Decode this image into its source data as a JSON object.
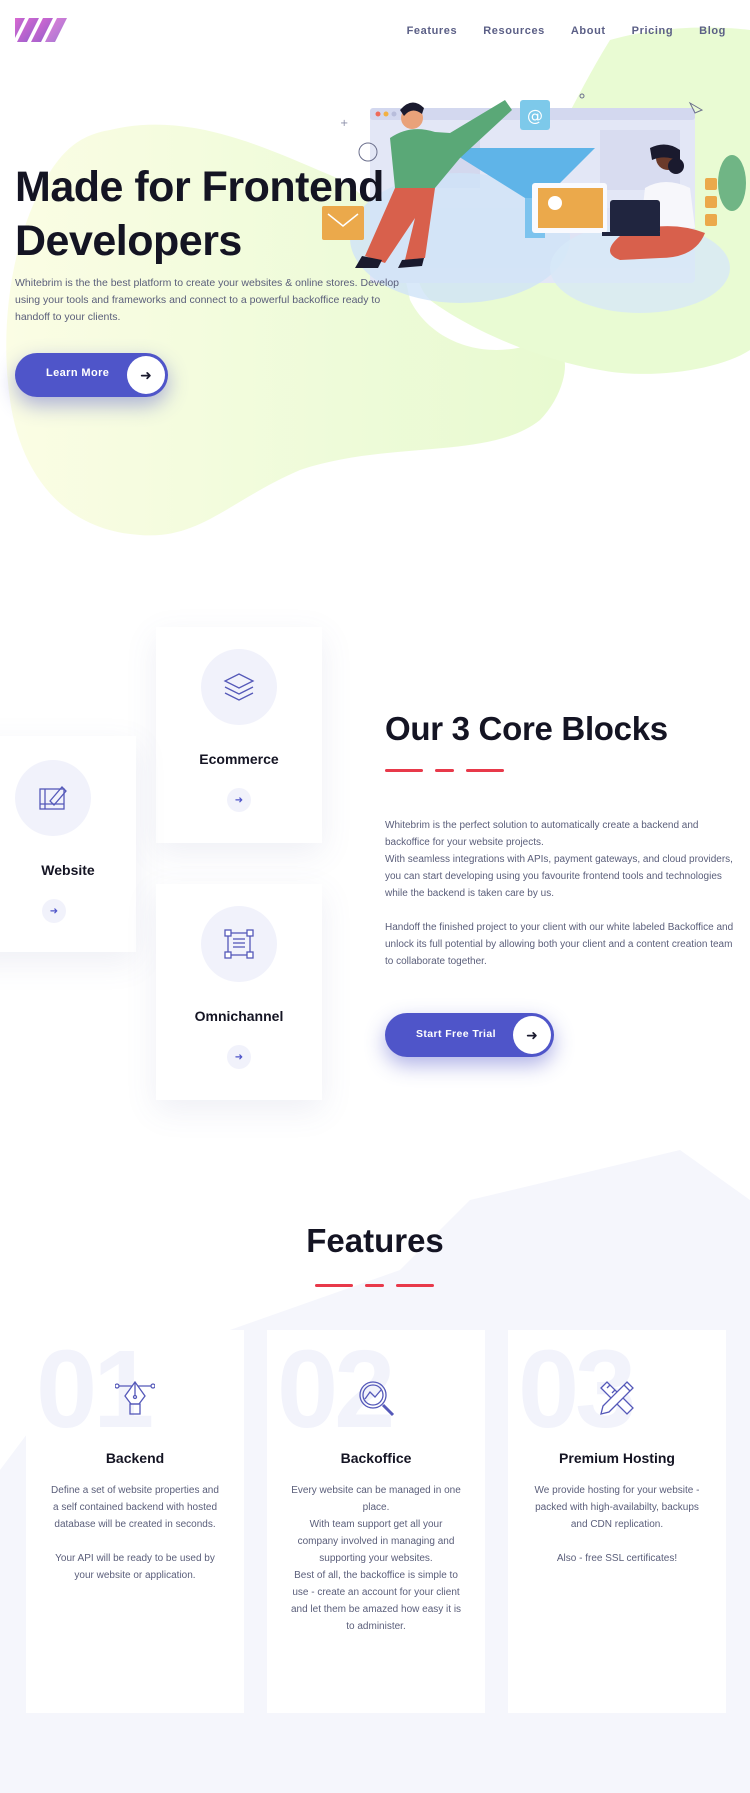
{
  "header": {
    "logo_icon": "stripes-logo-icon",
    "nav": [
      "Features",
      "Resources",
      "About",
      "Pricing",
      "Blog"
    ]
  },
  "hero": {
    "title": "Made for Frontend Developers",
    "description": "Whitebrim is the the best platform to create your websites & online stores. Develop using your tools and frameworks and connect to a powerful backoffice ready to handoff to your clients.",
    "cta_label": "Learn More",
    "cta_icon": "arrow-right-icon",
    "illustration": "team-workflow-illustration"
  },
  "core": {
    "cards": [
      {
        "title": "Ecommerce",
        "icon": "layers-icon"
      },
      {
        "title": "Website",
        "icon": "design-board-icon"
      },
      {
        "title": "Omnichannel",
        "icon": "layout-frame-icon"
      }
    ],
    "title": "Our 3 Core Blocks",
    "paragraph_1": "Whitebrim is the perfect solution to automatically create a backend and backoffice for your website projects.\nWith seamless integrations with APIs, payment gateways, and cloud providers, you can start developing using you favourite frontend tools and technologies while the backend is taken care by us.",
    "paragraph_2": "Handoff the finished project to your client with our white labeled Backoffice and unlock its full potential by allowing both your client and a content creation team to collaborate together.",
    "cta_label": "Start Free Trial"
  },
  "features": {
    "title": "Features",
    "items": [
      {
        "number": "01",
        "icon": "pen-tool-icon",
        "title": "Backend",
        "lines": [
          "Define a set of website properties and",
          "a self contained backend with hosted",
          "database will be created in seconds.",
          "",
          "Your API will be ready to be used by",
          "your website or application."
        ]
      },
      {
        "number": "02",
        "icon": "magnifier-chart-icon",
        "title": "Backoffice",
        "lines": [
          "Every website can be managed in one",
          "place.",
          "With team support get all your",
          "company involved in managing and",
          "supporting your websites.",
          "Best of all, the backoffice is simple to",
          "use - create an account for your client",
          "and let them be amazed how easy it is",
          "to administer."
        ]
      },
      {
        "number": "03",
        "icon": "pencil-ruler-icon",
        "title": "Premium Hosting",
        "lines": [
          "We provide hosting for your website -",
          "packed with high-availabilty, backups",
          "and CDN replication.",
          "",
          "Also - free SSL certificates!"
        ]
      }
    ]
  },
  "colors": {
    "accent": "#4f55c9",
    "red_lines": "#e8394a",
    "blob_green": "#e9fbd0",
    "heading": "#141423",
    "body_text": "#5a5e7a"
  }
}
